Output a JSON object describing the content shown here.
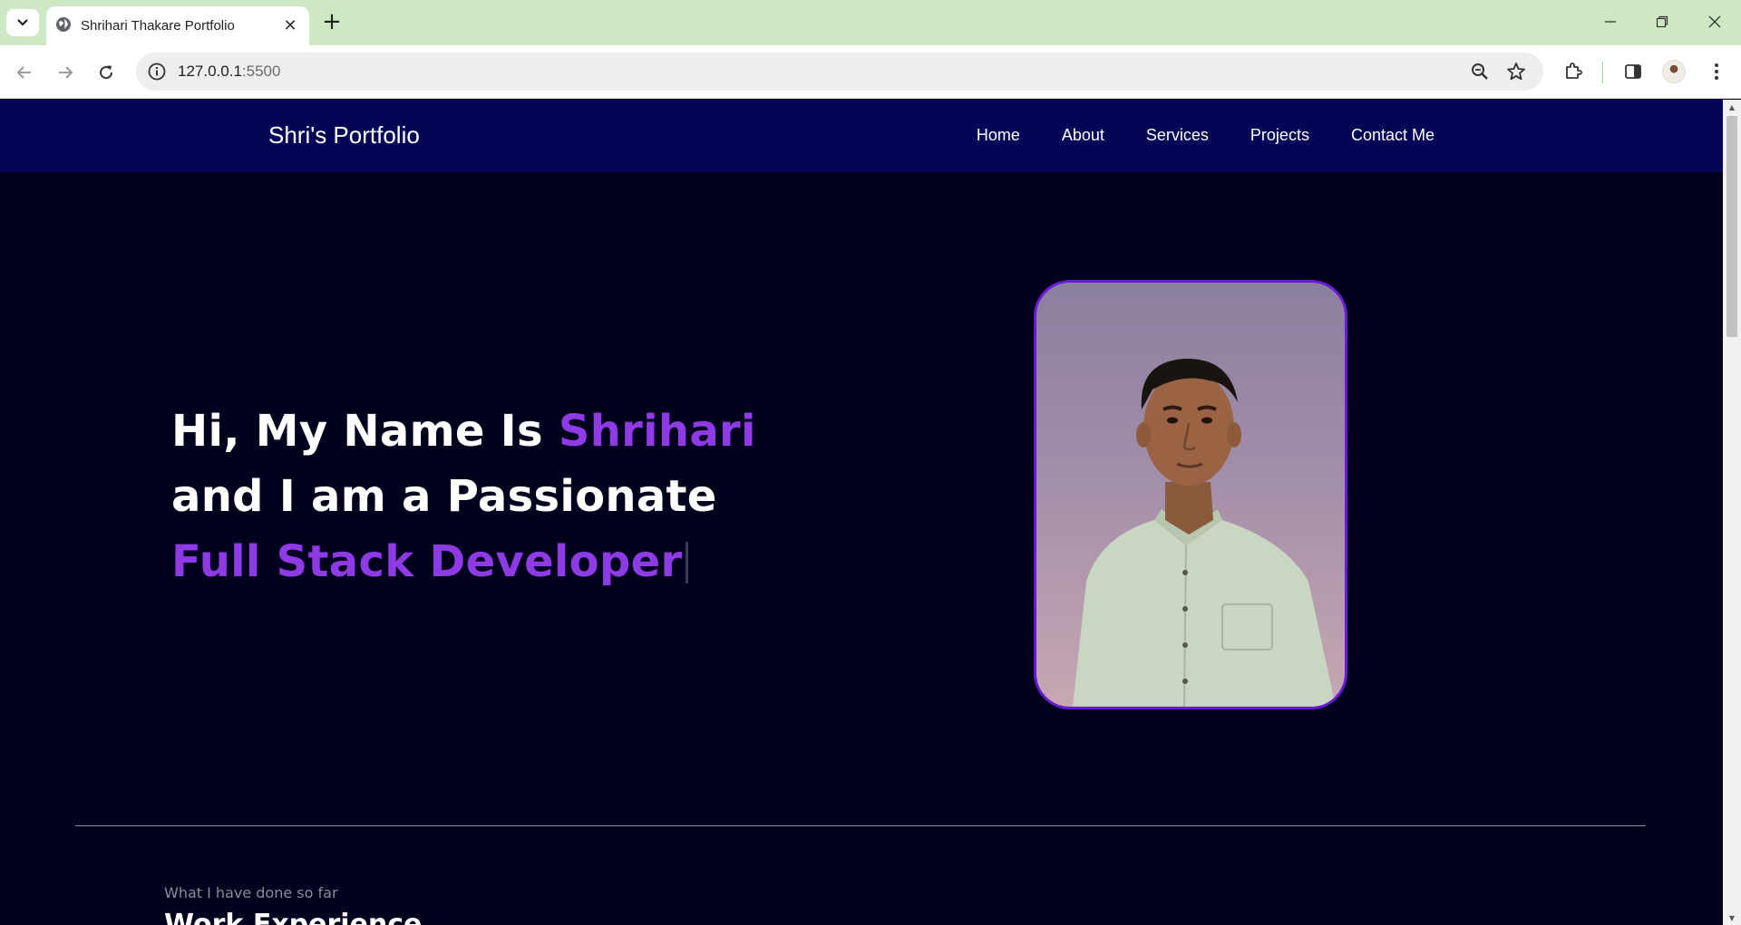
{
  "browser": {
    "tab_title": "Shrihari Thakare Portfolio",
    "url_host": "127.0.0.1",
    "url_port": ":5500",
    "tab_close_glyph": "✕",
    "new_tab_glyph": "+",
    "icons": [
      "tab-search-icon",
      "globe-icon",
      "close-icon",
      "plus-icon",
      "minimize-icon",
      "restore-icon",
      "window-close-icon",
      "back-icon",
      "forward-icon",
      "reload-icon",
      "site-info-icon",
      "zoom-icon",
      "star-icon",
      "extensions-icon",
      "side-panel-icon",
      "profile-avatar",
      "kebab-menu-icon"
    ]
  },
  "site": {
    "logo": "Shri's Portfolio",
    "nav": [
      {
        "label": "Home"
      },
      {
        "label": "About"
      },
      {
        "label": "Services"
      },
      {
        "label": "Projects"
      },
      {
        "label": "Contact Me"
      }
    ],
    "hero": {
      "line1_prefix": "Hi, My Name Is ",
      "line1_name": "Shrihari",
      "line2": "and I am a Passionate",
      "line3": "Full Stack Developer"
    },
    "section": {
      "subtitle": "What I have done so far",
      "title": "Work Experience"
    }
  },
  "colors": {
    "accent": "#8e3be6",
    "nav_bg": "#050558",
    "page_bg": "#01001d",
    "photo_border": "#6a19d6",
    "tabbar_bg": "#cfe8c4"
  }
}
